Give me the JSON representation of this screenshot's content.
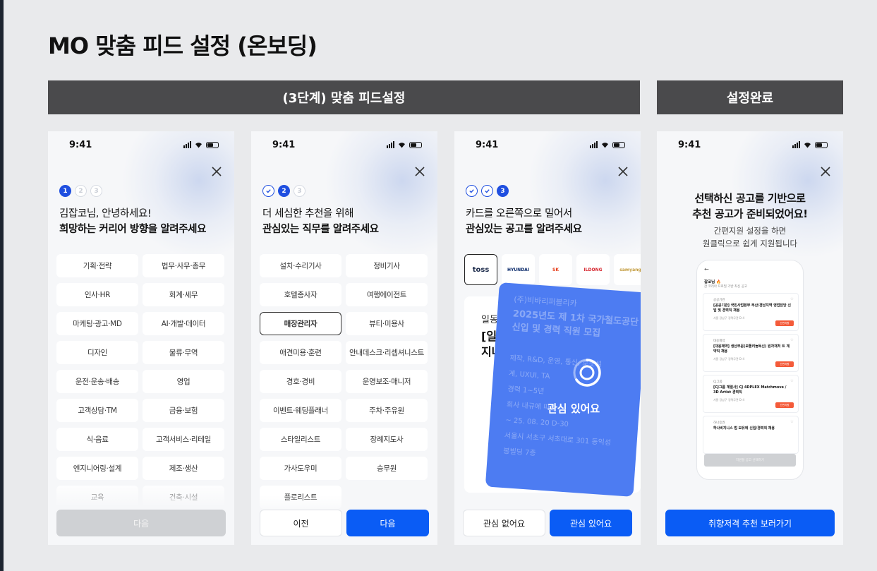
{
  "page_title": "MO 맞춤 피드 설정 (온보딩)",
  "sections": {
    "step3_label": "(3단계) 맞춤 피드설정",
    "complete_label": "설정완료"
  },
  "status_bar": {
    "time": "9:41"
  },
  "screen1": {
    "steps": [
      "1",
      "2",
      "3"
    ],
    "greeting": "김잡코님, 안녕하세요!",
    "prompt": "희망하는 커리어 방향을 알려주세요",
    "options": [
      "기획·전략",
      "법무·사무·총무",
      "인사·HR",
      "회계·세무",
      "마케팅·광고·MD",
      "AI·개발·데이터",
      "디자인",
      "물류·무역",
      "운전·운송·배송",
      "영업",
      "고객상담·TM",
      "금융·보험",
      "식·음료",
      "고객서비스·리테일",
      "엔지니어링·설계",
      "제조·생산",
      "교육",
      "건축·시설"
    ],
    "next_button": "다음"
  },
  "screen2": {
    "current_step": "2",
    "pending_step": "3",
    "line1": "더 세심한 추천을 위해",
    "line2": "관심있는 직무를 알려주세요",
    "options": [
      "설치·수리기사",
      "정비기사",
      "호텔종사자",
      "여행에이전트",
      "매장관리자",
      "뷰티·미용사",
      "애견미용·훈련",
      "안내데스크·리셉셔니스트",
      "경호·경비",
      "운영보조·매니저",
      "이벤트·웨딩플래너",
      "주차·주유원",
      "스타일리스트",
      "장례지도사",
      "가사도우미",
      "승무원",
      "플로리스트"
    ],
    "selected_option": "매장관리자",
    "prev_button": "이전",
    "next_button": "다음"
  },
  "screen3": {
    "current_step": "3",
    "line1": "카드를 오른쪽으로 밀어서",
    "line2": "관심있는 공고를 알려주세요",
    "logos": [
      "toss",
      "HYUNDAI",
      "SK",
      "ILDONG",
      "samyang"
    ],
    "bg_card": {
      "label": "일동",
      "title": "[일\n지나"
    },
    "swipe_card": {
      "company": "(주)비바리퍼블리카",
      "title": "2025년도 제 1차 국가철도공단\n신입 및 경력 직원 모집",
      "details": "제작, R&D, 운영, 통신, 로봇설\n계, UXUI, TA\n경력 1~5년\n회사 내규에 따름\n~ 25. 08. 20  D-30\n서울시 서초구 서초대로 301 동익성\n봉빌딩 7층"
    },
    "interest_label": "관심 있어요",
    "no_button": "관심 없어요",
    "yes_button": "관심 있어요"
  },
  "screen4": {
    "title": "선택하신 공고를 기반으로\n추천 공고가 준비되었어요!",
    "subtitle": "간편지원 설정을 하면\n원클릭으로 쉽게 지원됩니다",
    "mini": {
      "back": "←",
      "heading": "잡코님 🔥",
      "subheading": "잡 코리아 프로필 기반 최신 공고",
      "cards": [
        {
          "company": "공공기관",
          "title": "[공공기관] 국민사업본부 부산/경남지역 영업담당 신입 및 경력직 채용",
          "tags": "서울 강남구   경력무관   D-4",
          "badge": "간편지원"
        },
        {
          "company": "대웅제약",
          "title": "[대웅제약] 생산부문(보톨리눔독신) 원자재처 트 계약직 채용",
          "tags": "서울 강남구   경력무관   D-4",
          "badge": "간편지원"
        },
        {
          "company": "CJ그룹",
          "title": "[CJ그룹 계열사] CJ 4DPLEX Matchmove / 3D Artist 경력직",
          "tags": "서울 강남구   경력무관   D-4",
          "badge": "간편지원"
        },
        {
          "company": "하나증권",
          "title": "하나비지니스 법 보유에 신입/경력직 채용",
          "tags": "",
          "badge": ""
        }
      ],
      "apply_button": "지원할 공고 선택하기"
    },
    "cta_button": "취향저격 추천 보러가기"
  },
  "colors": {
    "primary": "#0a5cf5",
    "step_active": "#1f4fe0",
    "swipe_card": "#4d7cf2",
    "section_bar": "#4a4a4c",
    "mini_badge": "#f45b3a"
  }
}
